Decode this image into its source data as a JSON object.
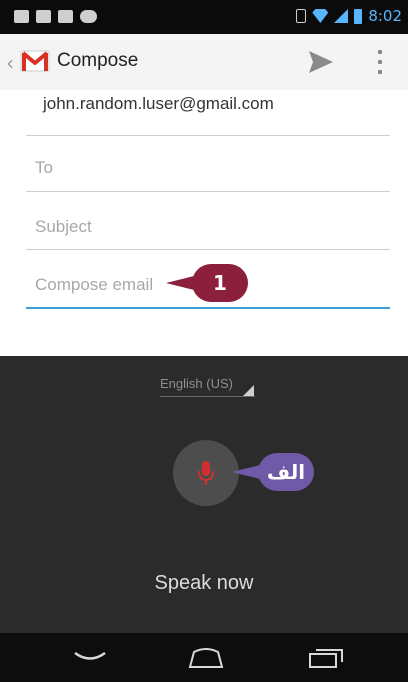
{
  "status_bar": {
    "time": "8:02"
  },
  "action_bar": {
    "title": "Compose"
  },
  "form": {
    "from": "john.random.luser@gmail.com",
    "to_placeholder": "To",
    "subject_placeholder": "Subject",
    "body_placeholder": "Compose email"
  },
  "callouts": {
    "first": "1",
    "second": "الف"
  },
  "voice": {
    "language": "English (US)",
    "prompt": "Speak now"
  },
  "colors": {
    "accent_blue": "#3aa2d8",
    "callout_red": "#8b1f3c",
    "callout_purple": "#6f5aa8",
    "mic_red": "#d03030"
  }
}
